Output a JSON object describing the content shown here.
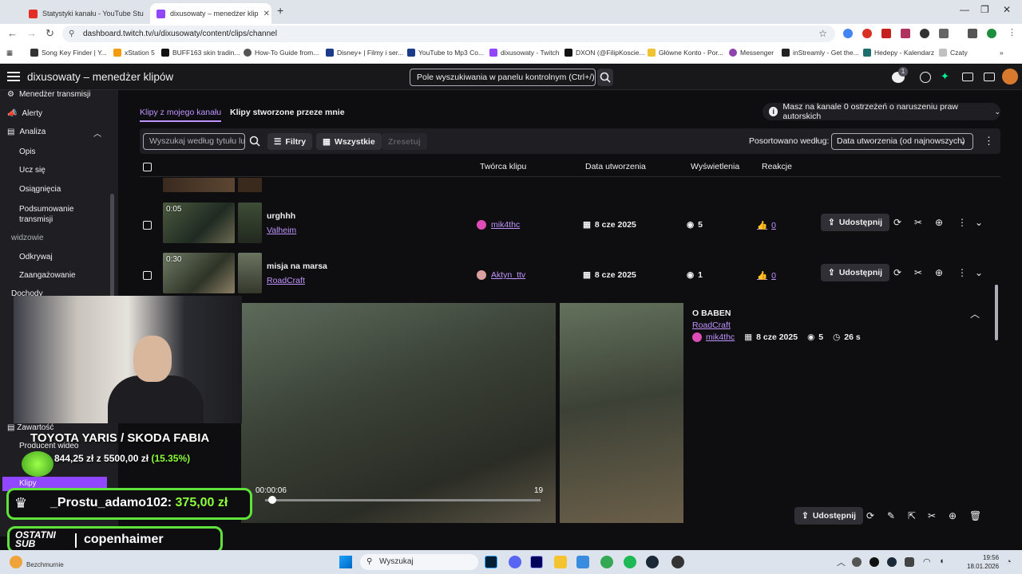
{
  "browser": {
    "tabs": [
      {
        "title": "Statystyki kanału - YouTube Stu",
        "active": false
      },
      {
        "title": "dixusowaty – menedżer klip",
        "active": true
      }
    ],
    "new_tab": "+",
    "url": "dashboard.twitch.tv/u/dixusowaty/content/clips/channel",
    "bookmarks": [
      "Song Key Finder | Y...",
      "xStation 5",
      "BUFF163 skin tradin...",
      "How-To Guide from...",
      "Disney+ | Filmy i ser...",
      "YouTube to Mp3 Co...",
      "dixusowaty - Twitch",
      "DXON (@FilipKoscie...",
      "Główne Konto - Por...",
      "Messenger",
      "inStreamly - Get the...",
      "Hedepy - Kalendarz",
      "Czaty"
    ]
  },
  "header": {
    "title": "dixusowaty – menedżer klipów",
    "search_placeholder": "Pole wyszukiwania w panelu kontrolnym (Ctrl+/)",
    "notification_count": "1"
  },
  "sidebar": {
    "items": [
      {
        "label": "Menedżer transmisji"
      },
      {
        "label": "Alerty"
      },
      {
        "label": "Analiza"
      }
    ],
    "analiza_sub": [
      "Opis",
      "Ucz się",
      "Osiągnięcia",
      "Podsumowanie transmisji"
    ],
    "section_head": "widzowie",
    "widzowie_sub": [
      "Odkrywaj",
      "Zaangażowanie"
    ],
    "hidden_head": "Dochody",
    "content_head": "Zawartość",
    "content_sub": [
      "Producent wideo",
      "Klipy"
    ]
  },
  "tabs": {
    "mine": "Klipy z mojego kanału",
    "created": "Klipy stworzone przeze mnie"
  },
  "copyright": "Masz na kanale 0 ostrzeżeń o naruszeniu praw autorskich",
  "filters": {
    "search_placeholder": "Wyszukaj według tytułu lu",
    "filters_label": "Filtry",
    "all_label": "Wszystkie",
    "reset_label": "Zresetuj",
    "sort_label": "Posortowano według:",
    "sort_value": "Data utworzenia (od najnowszych)"
  },
  "table": {
    "headers": {
      "creator": "Twórca klipu",
      "date": "Data utworzenia",
      "views": "Wyświetlenia",
      "reactions": "Reakcje"
    },
    "rows": [
      {
        "duration": "0:05",
        "title": "urghhh",
        "game": "Valheim",
        "creator": "mik4thc",
        "date": "8 cze 2025",
        "views": "5",
        "reactions": "0",
        "share": "Udostępnij"
      },
      {
        "duration": "0:30",
        "title": "misja na marsa",
        "game": "RoadCraft",
        "creator": "Aktyn_ttv",
        "date": "8 cze 2025",
        "views": "1",
        "reactions": "0",
        "share": "Udostępnij"
      }
    ]
  },
  "detail": {
    "title": "O BABEN",
    "game": "RoadCraft",
    "creator": "mik4thc",
    "date": "8 cze 2025",
    "views": "5",
    "duration": "26 s",
    "player_time": "00:00:06",
    "player_number": "19",
    "share": "Udostępnij"
  },
  "overlay": {
    "goal_title": "TOYOTA YARIS / SKODA FABIA",
    "goal_amount": "844,25 zł",
    "goal_of": "z 5500,00 zł",
    "goal_pct": "(15.35%)",
    "donation_name": "_Prostu_adamo102:",
    "donation_amount": "375,00 zł",
    "last_sub_label": "OSTATNI SUB",
    "last_sub_name": "copenhaimer"
  },
  "taskbar": {
    "search": "Wyszukaj",
    "time": "19:56",
    "date": "18.01.2026",
    "weather": "Bezchmurnie"
  },
  "colors": {
    "accent": "#bf94ff",
    "twitch_purple": "#9147ff",
    "overlay_green": "#5fe33a"
  }
}
